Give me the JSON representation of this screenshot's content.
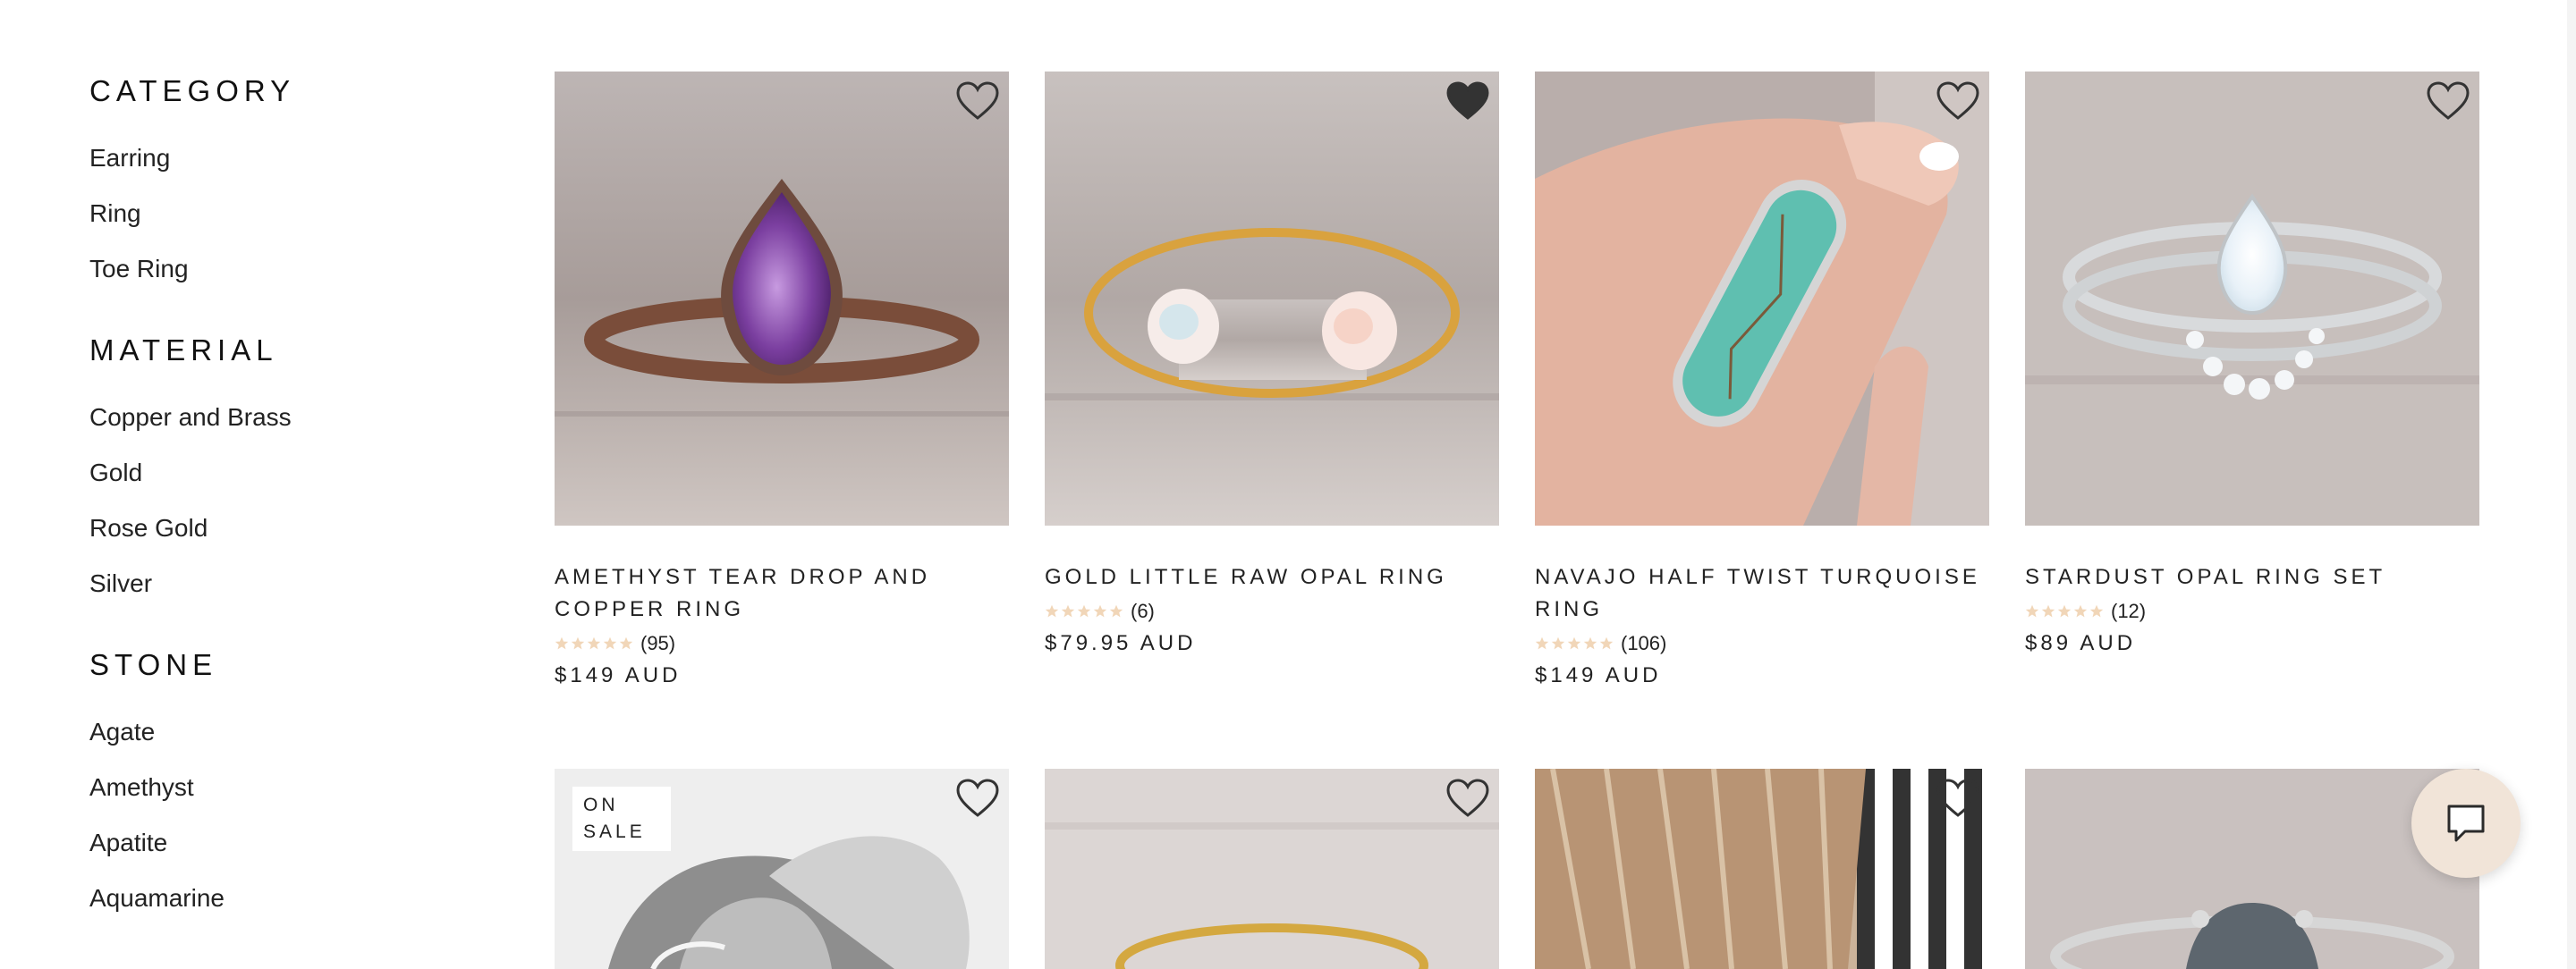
{
  "sidebar": {
    "groups": [
      {
        "title": "CATEGORY",
        "items": [
          "Earring",
          "Ring",
          "Toe Ring"
        ]
      },
      {
        "title": "MATERIAL",
        "items": [
          "Copper and Brass",
          "Gold",
          "Rose Gold",
          "Silver"
        ]
      },
      {
        "title": "STONE",
        "items": [
          "Agate",
          "Amethyst",
          "Apatite",
          "Aquamarine"
        ]
      }
    ]
  },
  "products": [
    {
      "title": "AMETHYST TEAR DROP AND COPPER RING",
      "rating_count": "(95)",
      "price": "$149 AUD",
      "favorited": false
    },
    {
      "title": "GOLD LITTLE RAW OPAL RING",
      "rating_count": "(6)",
      "price": "$79.95 AUD",
      "favorited": true
    },
    {
      "title": "NAVAJO HALF TWIST TURQUOISE RING",
      "rating_count": "(106)",
      "price": "$149 AUD",
      "favorited": false
    },
    {
      "title": "STARDUST OPAL RING SET",
      "rating_count": "(12)",
      "price": "$89 AUD",
      "favorited": false
    }
  ],
  "second_row": {
    "sale_badge": "ON SALE"
  },
  "colors": {
    "heart": "#333333",
    "star": "#f1d6b8",
    "chat_bg": "#f1e4d8"
  },
  "icons": {
    "favorite": "heart-icon",
    "chat": "chat-bubble-icon",
    "rating": "star-icon"
  }
}
